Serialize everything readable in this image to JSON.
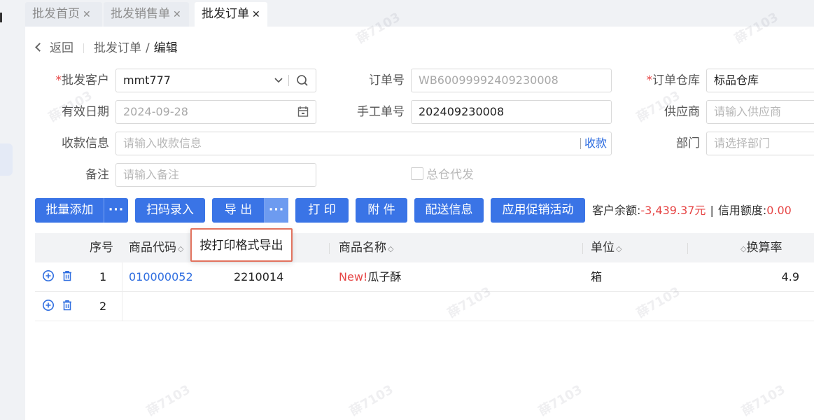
{
  "tabs": [
    {
      "label": "批发首页",
      "close": "✕"
    },
    {
      "label": "批发销售单",
      "close": "✕"
    },
    {
      "label": "批发订单",
      "close": "✕"
    }
  ],
  "breadcrumb": {
    "back": "返回",
    "parent": "批发订单",
    "sep": "/",
    "current": "编辑"
  },
  "form": {
    "customer": {
      "label": "批发客户",
      "req": "*",
      "value": "mmt777"
    },
    "order_no": {
      "label": "订单号",
      "value": "WB60099992409230008"
    },
    "warehouse": {
      "label": "订单仓库",
      "req": "*",
      "value": "标品仓库"
    },
    "valid_date": {
      "label": "有效日期",
      "value": "2024-09-28"
    },
    "manual_no": {
      "label": "手工单号",
      "value": "202409230008"
    },
    "supplier": {
      "label": "供应商",
      "placeholder": "请输入供应商"
    },
    "payment": {
      "label": "收款信息",
      "placeholder": "请输入收款信息",
      "action": "收款"
    },
    "dept": {
      "label": "部门",
      "placeholder": "请选择部门"
    },
    "remark": {
      "label": "备注",
      "placeholder": "请输入备注"
    },
    "ship_all": {
      "label": "总仓代发"
    }
  },
  "toolbar": {
    "batch_add": "批量添加",
    "scan": "扫码录入",
    "export": "导 出",
    "print": "打 印",
    "attach": "附 件",
    "delivery": "配送信息",
    "promo": "应用促销活动",
    "more": "···"
  },
  "balance": {
    "label": "客户余额:",
    "value": "-3,439.37元",
    "sep": "|",
    "credit_label": "信用额度:",
    "credit_value": "0.00"
  },
  "table": {
    "headers": {
      "seq": "序号",
      "code": "商品代码",
      "barcode": "",
      "name": "商品名称",
      "unit": "单位",
      "rate": "换算率"
    },
    "sort": "◇",
    "rows": [
      {
        "seq": "1",
        "code": "010000052",
        "barcode": "2210014",
        "new": "New!",
        "name": "瓜子酥",
        "unit": "箱",
        "rate": "4.9"
      },
      {
        "seq": "2",
        "code": "",
        "barcode": "",
        "new": "",
        "name": "",
        "unit": "",
        "rate": ""
      }
    ]
  },
  "export_menu": {
    "item": "按打印格式导出"
  },
  "watermark": "薛7103"
}
